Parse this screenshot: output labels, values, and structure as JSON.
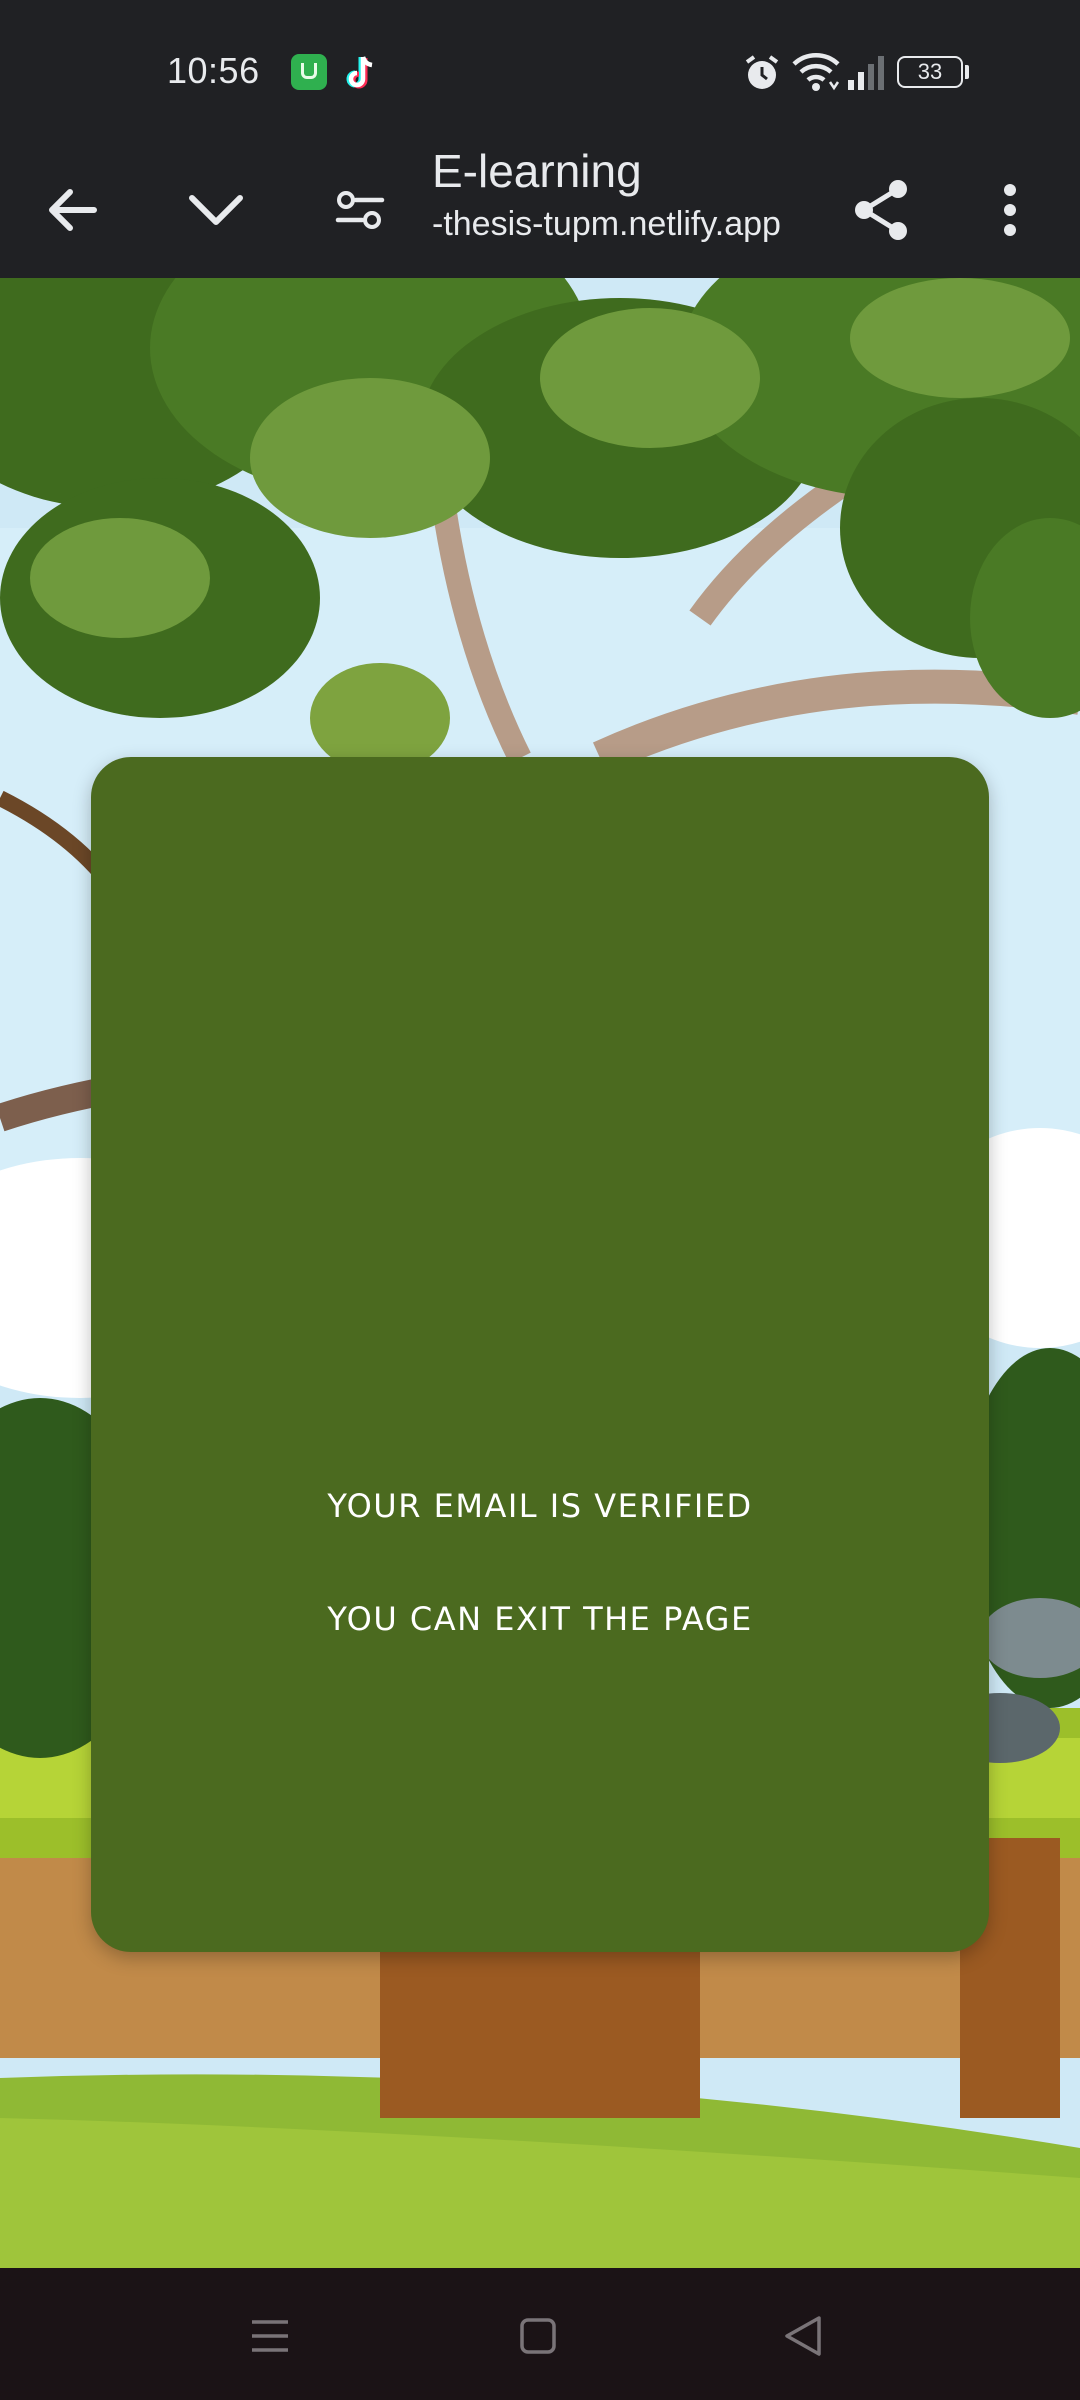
{
  "status_bar": {
    "time": "10:56",
    "battery": "33",
    "icons": [
      "app-store-icon",
      "tiktok-icon",
      "alarm-icon",
      "wifi-icon",
      "signal-icon",
      "battery-icon"
    ]
  },
  "toolbar": {
    "title": "E-learning",
    "url": "-thesis-tupm.netlify.app",
    "icons": [
      "back-arrow-icon",
      "chevron-down-icon",
      "tune-icon",
      "share-icon",
      "more-vert-icon"
    ]
  },
  "card": {
    "line1": "YOUR EMAIL IS VERIFIED",
    "line2": "YOU CAN EXIT THE PAGE",
    "color": "#4b6a1f"
  },
  "nav_bar": {
    "icons": [
      "menu-icon",
      "home-square-icon",
      "back-triangle-icon"
    ]
  }
}
